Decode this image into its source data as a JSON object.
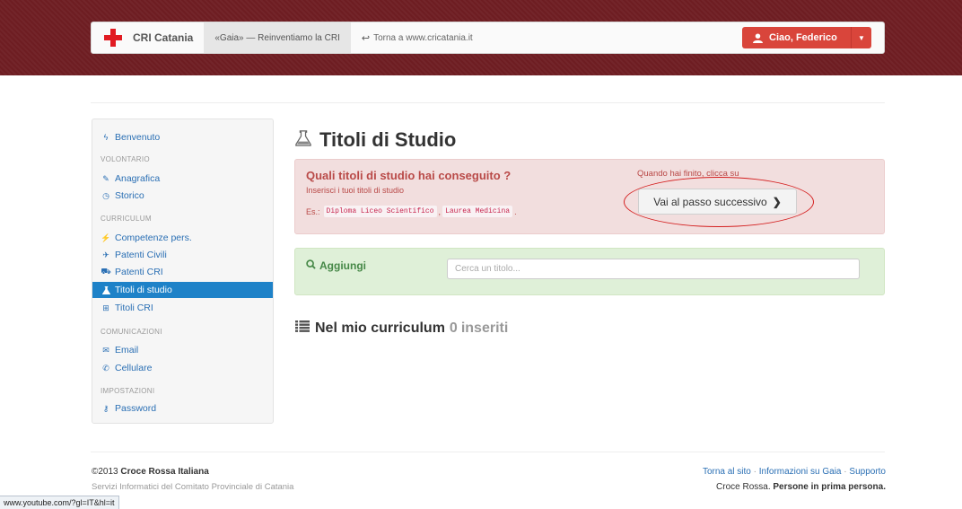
{
  "header": {
    "brand": "CRI Catania",
    "nav_active": "«Gaia» — Reinventiamo la CRI",
    "back_link": "Torna a www.cricatania.it",
    "user_button": "Ciao, Federico"
  },
  "sidebar": {
    "welcome": "Benvenuto",
    "sections": {
      "volontario": "VOLONTARIO",
      "curriculum": "CURRICULUM",
      "comunicazioni": "COMUNICAZIONI",
      "impostazioni": "IMPOSTAZIONI"
    },
    "items": {
      "anagrafica": "Anagrafica",
      "storico": "Storico",
      "competenze": "Competenze pers.",
      "patenti_civili": "Patenti Civili",
      "patenti_cri": "Patenti CRI",
      "titoli_studio": "Titoli di studio",
      "titoli_cri": "Titoli CRI",
      "email": "Email",
      "cellulare": "Cellulare",
      "password": "Password"
    }
  },
  "main": {
    "title": "Titoli di Studio",
    "alert": {
      "question": "Quali titoli di studio hai conseguito ?",
      "subtitle": "Inserisci i tuoi titoli di studio",
      "example_prefix": "Es.:",
      "example_1": "Diploma Liceo Scientifico",
      "example_2": "Laurea Medicina",
      "when_done": "Quando hai finito, clicca su",
      "next_button": "Vai al passo successivo"
    },
    "add": {
      "label": "Aggiungi",
      "placeholder": "Cerca un titolo..."
    },
    "curriculum": {
      "label": "Nel mio curriculum",
      "count": "0",
      "suffix": "inseriti"
    }
  },
  "footer": {
    "copyright": "©2013",
    "org": "Croce Rossa Italiana",
    "subtitle": "Servizi Informatici del Comitato Provinciale di Catania",
    "links": [
      "Torna al sito",
      "Informazioni su Gaia",
      "Supporto"
    ],
    "separator": "·",
    "slogan_prefix": "Croce Rossa.",
    "slogan_bold": "Persone in prima persona."
  },
  "status_url": "www.youtube.com/?gl=IT&hl=it",
  "colors": {
    "brand_red": "#e11b22",
    "header_band": "#6e1d22",
    "active_blue": "#1e82c8",
    "link_blue": "#2a6fb4",
    "danger_text": "#b94a48",
    "success_text": "#468847"
  }
}
